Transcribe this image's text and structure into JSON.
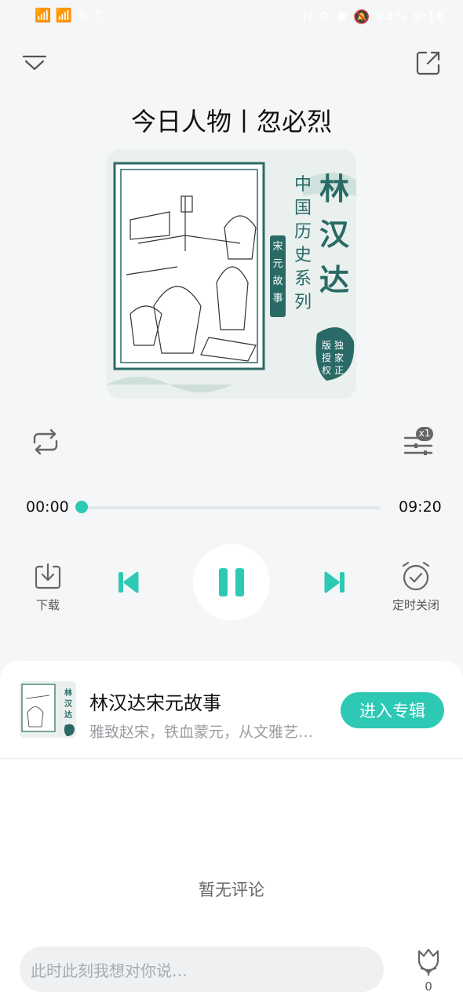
{
  "status_bar": {
    "left_icons": "📶 📶 ≋ ♫",
    "right": "N ⚙ ✱ 🔕 94% 9:16"
  },
  "header": {
    "title": "今日人物丨忽必烈"
  },
  "cover_art": {
    "series_title": "林汉达",
    "series_subtitle": "中国历史系列",
    "tag": "宋元故事",
    "badge": "独家正版授权"
  },
  "player": {
    "current_time": "00:00",
    "total_time": "09:20",
    "progress": 0.0,
    "speed": "x1",
    "download_label": "下载",
    "timer_label": "定时关闭"
  },
  "album": {
    "title": "林汉达宋元故事",
    "description": "雅致赵宋，铁血蒙元，从文雅艺…",
    "enter_label": "进入专辑"
  },
  "comments": {
    "empty_text": "暂无评论",
    "input_placeholder": "此时此刻我想对你说…",
    "like_count": "0"
  },
  "colors": {
    "accent": "#2ec9b4",
    "background": "#f4f6f7"
  }
}
